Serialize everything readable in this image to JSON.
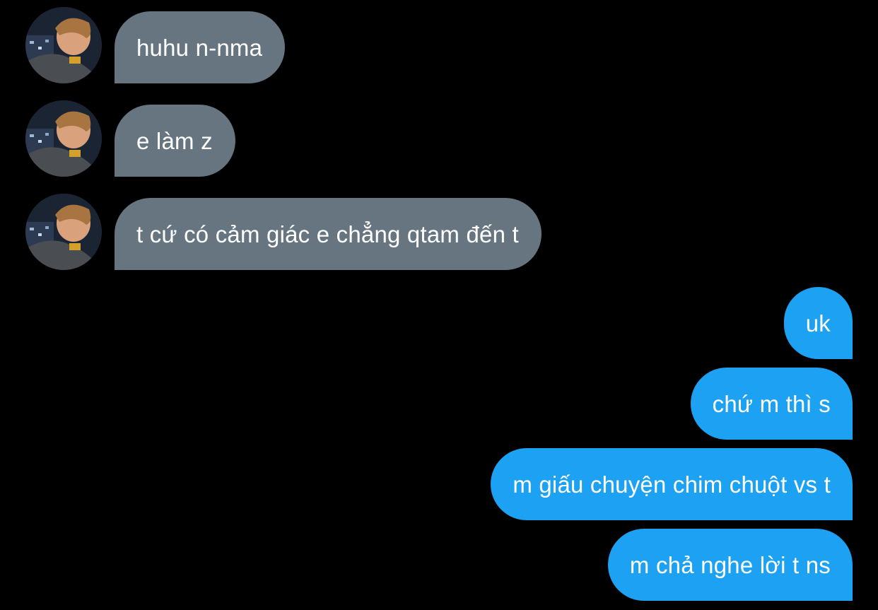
{
  "conversation": {
    "incoming": [
      {
        "text": "huhu n-nma",
        "avatar": "user-avatar-photo"
      },
      {
        "text": "e làm z",
        "avatar": "user-avatar-photo"
      },
      {
        "text": "t cứ có cảm giác e chẳng qtam đến t",
        "avatar": "user-avatar-photo"
      }
    ],
    "outgoing": [
      {
        "text": "uk"
      },
      {
        "text": "chứ m thì s"
      },
      {
        "text": "m giấu chuyện chim chuột vs t"
      },
      {
        "text": "m chả nghe lời t ns"
      }
    ]
  },
  "colors": {
    "background": "#000000",
    "incoming_bubble": "#66757f",
    "outgoing_bubble": "#1da1f2",
    "text": "#ffffff"
  }
}
